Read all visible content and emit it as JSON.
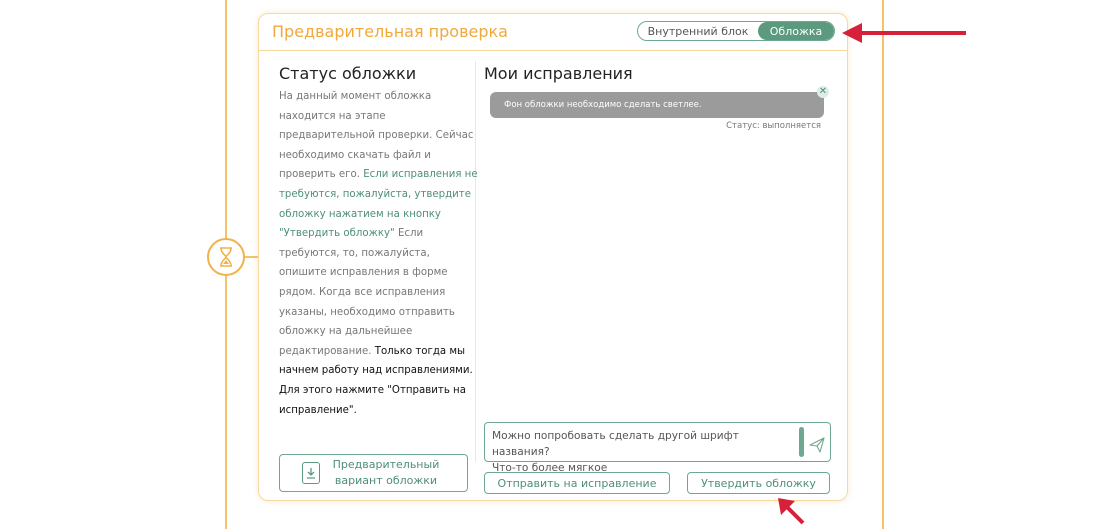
{
  "card": {
    "title": "Предварительная проверка",
    "toggle": {
      "inner_label": "Внутренний блок",
      "cover_label": "Обложка",
      "selected": "Обложка"
    }
  },
  "status": {
    "title": "Статус обложки",
    "text_1": "На данный момент обложка находится на этапе предварительной проверки. Сейчас необходимо скачать файл и проверить его.",
    "text_green": "Если исправления не требуются, пожалуйста, утвердите обложку нажатием на кнопку \"Утвердить обложку\"",
    "text_2": "Если требуются, то, пожалуйста, опишите исправления в форме рядом. Когда все исправления указаны, необходимо отправить обложку на дальнейшее редактирование.",
    "text_bold": "Только тогда мы начнем работу над исправлениями. Для этого нажмите \"Отправить на исправление\".",
    "download_label": "Предварительный вариант обложки"
  },
  "fixes": {
    "title": "Мои исправления",
    "messages": [
      {
        "text": "Фон обложки необходимо сделать светлее.",
        "status": "Статус: выполняется"
      }
    ],
    "input_value": "Можно попробовать сделать другой шрифт названия?\nЧто-то более мягкое"
  },
  "buttons": {
    "send_fix": "Отправить на исправление",
    "approve": "Утвердить обложку"
  },
  "colors": {
    "accent_orange": "#f0a93a",
    "accent_green": "#5c9a80",
    "arrow_red": "#d6213a"
  },
  "icons": [
    "hourglass-icon",
    "download-icon",
    "send-icon",
    "close-icon"
  ]
}
